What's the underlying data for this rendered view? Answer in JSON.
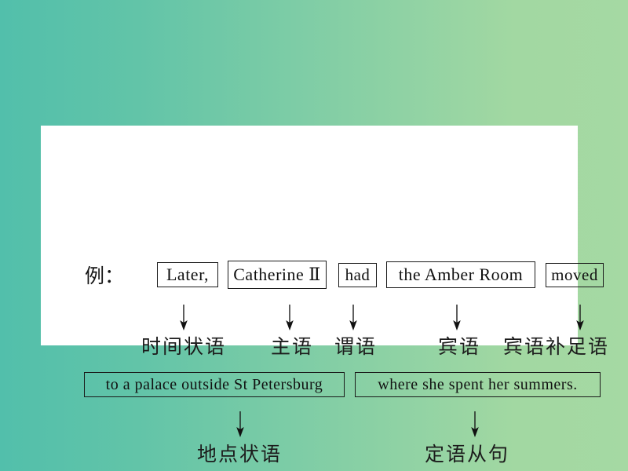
{
  "slide": {
    "background": {
      "gradient_from": "#52bfab",
      "gradient_to": "#a2d8a2",
      "direction": "left-to-right"
    },
    "card_background": "#ffffff"
  },
  "example": {
    "marker": "例：",
    "sentence_row1": [
      {
        "text": "Later,",
        "boxed": true,
        "role": "时间状语"
      },
      {
        "text": "Catherine Ⅱ",
        "boxed": true,
        "role": "主语"
      },
      {
        "text": "had",
        "boxed": true,
        "role": "谓语"
      },
      {
        "text": "the Amber Room",
        "boxed": true,
        "role": "宾语"
      },
      {
        "text": "moved",
        "boxed": true,
        "role": "宾语补足语"
      }
    ],
    "sentence_row2": [
      {
        "text": "to a palace outside St Petersburg",
        "boxed": true,
        "role": "地点状语"
      },
      {
        "text": "where she spent her summers.",
        "boxed": true,
        "role": "定语从句"
      }
    ]
  },
  "tokens": {
    "t1": "Later,",
    "t2": "Catherine Ⅱ",
    "t3": "had",
    "t4": "the Amber Room",
    "t5": "moved",
    "t6": "to a palace outside St Petersburg",
    "t7": "where she spent her summers."
  },
  "roles": {
    "r1": "时间状语",
    "r2": "主语",
    "r3": "谓语",
    "r4": "宾语",
    "r5": "宾语补足语",
    "r6": "地点状语",
    "r7": "定语从句"
  },
  "icons": {
    "arrow": "down-arrow-icon"
  }
}
